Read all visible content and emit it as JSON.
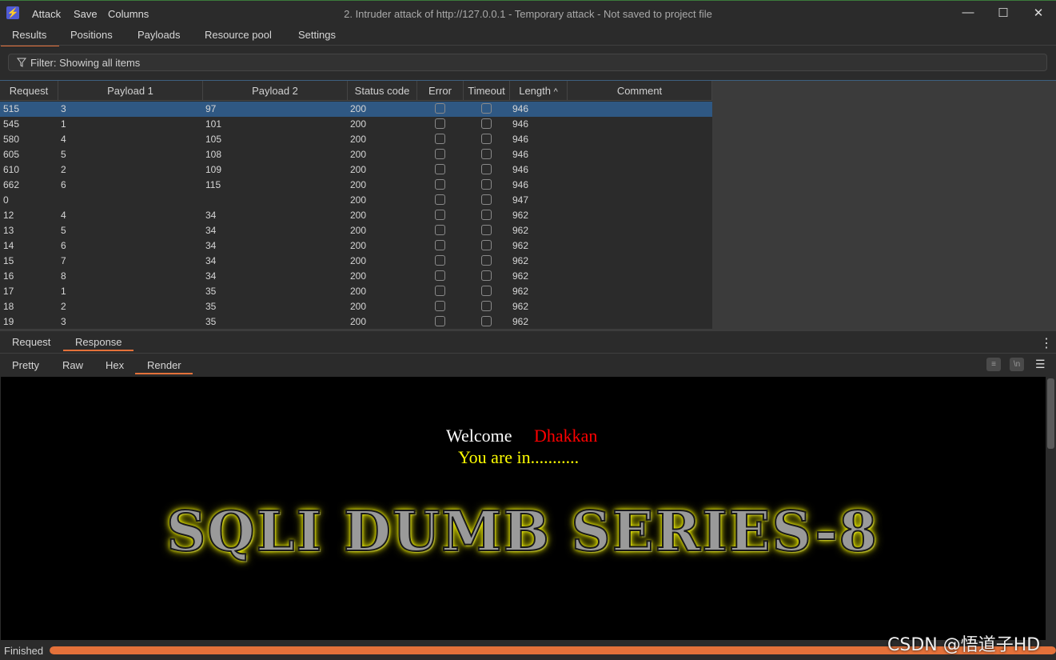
{
  "titlebar": {
    "app_icon": "burp-lightning-icon",
    "menu": [
      "Attack",
      "Save",
      "Columns"
    ],
    "window_title": "2. Intruder attack of http://127.0.0.1 - Temporary attack - Not saved to project file",
    "controls": {
      "minimize": "—",
      "maximize": "☐",
      "close": "✕"
    }
  },
  "top_tabs": [
    "Results",
    "Positions",
    "Payloads",
    "Resource pool",
    "Settings"
  ],
  "active_top_tab": "Results",
  "filter": {
    "text": "Filter: Showing all items",
    "icon": "filter-funnel-icon"
  },
  "table": {
    "columns": [
      "Request",
      "Payload 1",
      "Payload 2",
      "Status code",
      "Error",
      "Timeout",
      "Length",
      "Comment"
    ],
    "sort_indicator": "^",
    "rows": [
      [
        "515",
        "3",
        "97",
        "200",
        false,
        false,
        "946"
      ],
      [
        "545",
        "1",
        "101",
        "200",
        false,
        false,
        "946"
      ],
      [
        "580",
        "4",
        "105",
        "200",
        false,
        false,
        "946"
      ],
      [
        "605",
        "5",
        "108",
        "200",
        false,
        false,
        "946"
      ],
      [
        "610",
        "2",
        "109",
        "200",
        false,
        false,
        "946"
      ],
      [
        "662",
        "6",
        "115",
        "200",
        false,
        false,
        "946"
      ],
      [
        "0",
        "",
        "",
        "200",
        false,
        false,
        "947"
      ],
      [
        "12",
        "4",
        "34",
        "200",
        false,
        false,
        "962"
      ],
      [
        "13",
        "5",
        "34",
        "200",
        false,
        false,
        "962"
      ],
      [
        "14",
        "6",
        "34",
        "200",
        false,
        false,
        "962"
      ],
      [
        "15",
        "7",
        "34",
        "200",
        false,
        false,
        "962"
      ],
      [
        "16",
        "8",
        "34",
        "200",
        false,
        false,
        "962"
      ],
      [
        "17",
        "1",
        "35",
        "200",
        false,
        false,
        "962"
      ],
      [
        "18",
        "2",
        "35",
        "200",
        false,
        false,
        "962"
      ],
      [
        "19",
        "3",
        "35",
        "200",
        false,
        false,
        "962"
      ]
    ],
    "selected_row": 0
  },
  "message_tabs": [
    "Request",
    "Response"
  ],
  "active_message_tab": "Response",
  "view_tabs": [
    "Pretty",
    "Raw",
    "Hex",
    "Render"
  ],
  "active_view_tab": "Render",
  "view_tools": {
    "wrap": "≡",
    "newline": "\\n",
    "menu": "☰"
  },
  "render": {
    "welcome": "Welcome",
    "name": "Dhakkan",
    "message": "You are in...........",
    "banner": "SQLI DUMB SERIES-8"
  },
  "status": {
    "text": "Finished",
    "progress": 1.0
  },
  "watermark": "CSDN @悟道子HD"
}
